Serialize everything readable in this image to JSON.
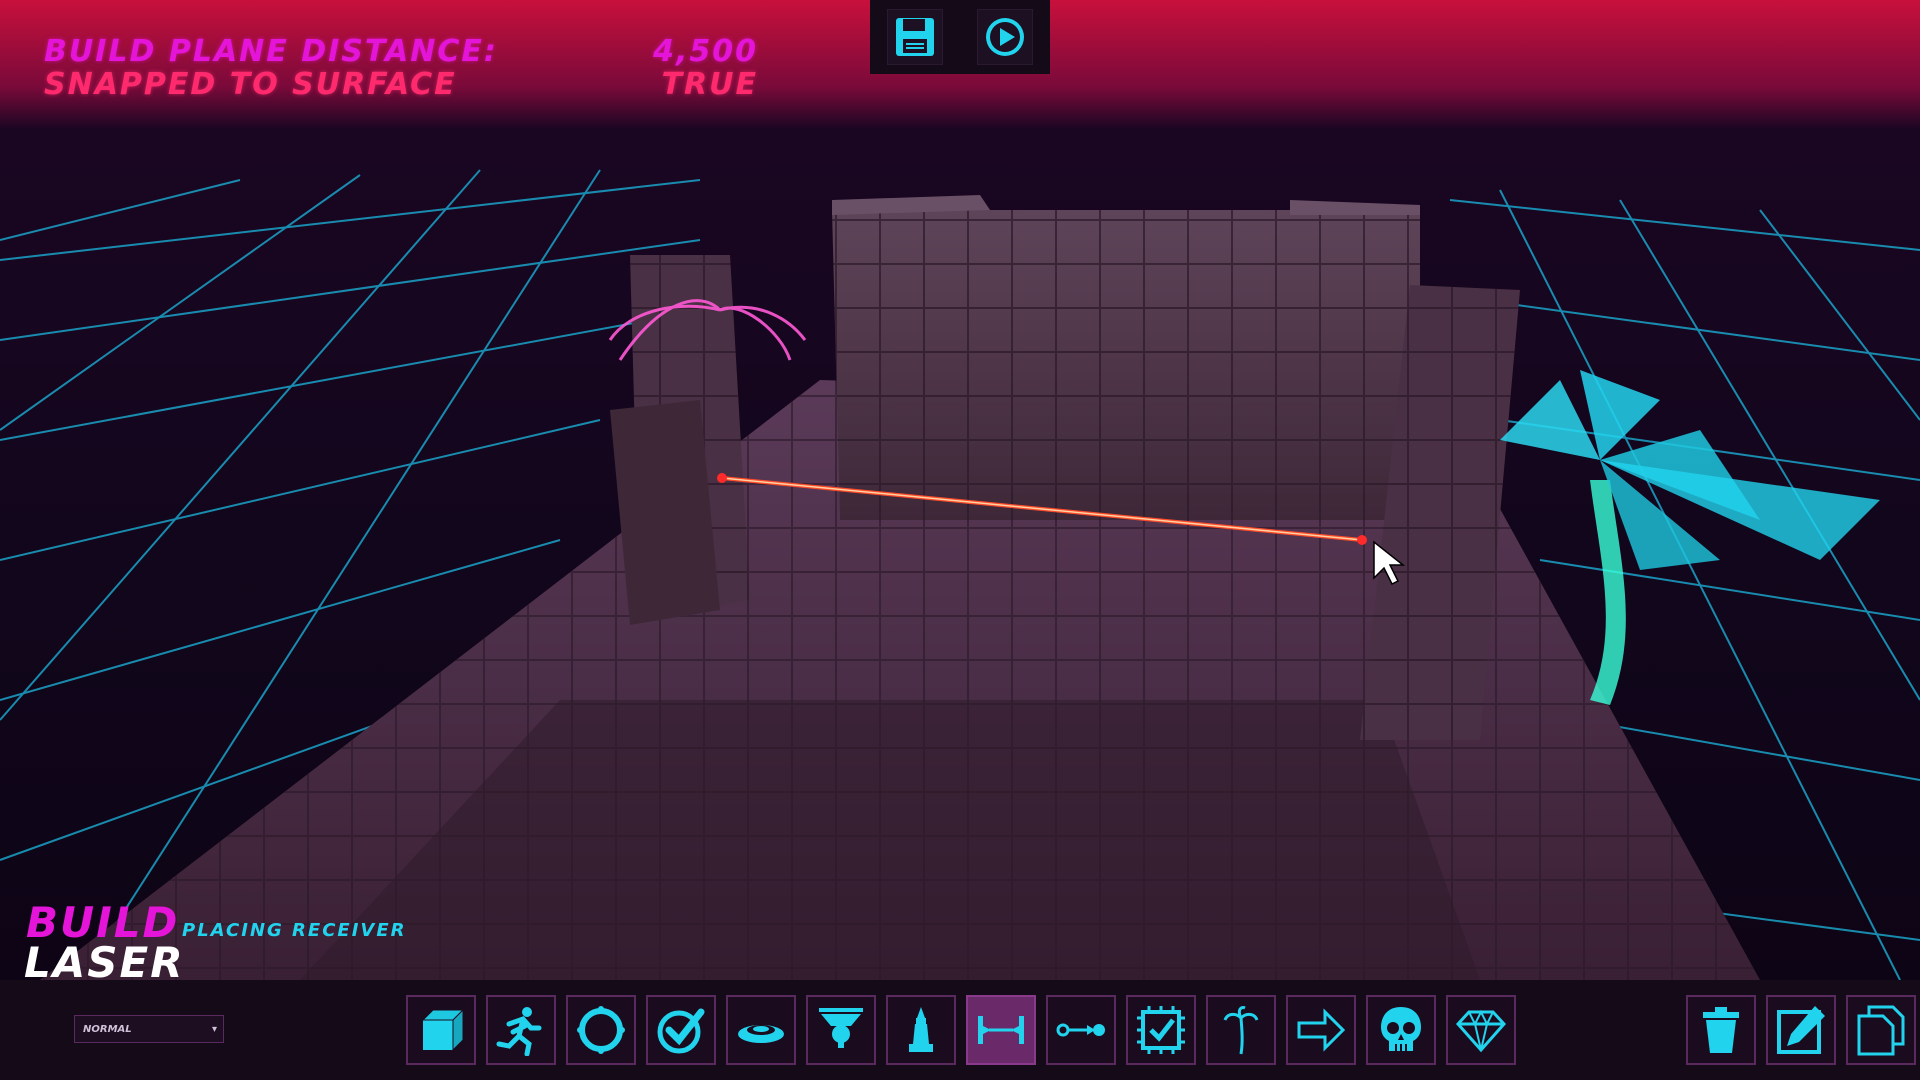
{
  "hud": {
    "build_plane_label": "BUILD PLANE DISTANCE:",
    "build_plane_value": "4,500",
    "snapped_label": "SNAPPED TO SURFACE",
    "snapped_value": "TRUE"
  },
  "top_toolbar": {
    "buttons": [
      {
        "icon": "save-icon"
      },
      {
        "icon": "play-icon"
      }
    ]
  },
  "mode": {
    "title": "BUILD",
    "status": "PLACING RECEIVER",
    "tool": "LASER"
  },
  "bottom_bar": {
    "mode_select_value": "NORMAL",
    "tools": [
      {
        "icon": "cube-icon"
      },
      {
        "icon": "runner-icon"
      },
      {
        "icon": "ring-icon"
      },
      {
        "icon": "checkmark-badge-icon"
      },
      {
        "icon": "disc-platform-icon"
      },
      {
        "icon": "ceiling-turret-icon"
      },
      {
        "icon": "tower-icon"
      },
      {
        "icon": "laser-icon",
        "active": true
      },
      {
        "icon": "connector-icon"
      },
      {
        "icon": "chip-check-icon"
      },
      {
        "icon": "palm-tree-icon"
      },
      {
        "icon": "arrow-right-icon"
      },
      {
        "icon": "skull-icon"
      },
      {
        "icon": "diamond-icon"
      }
    ],
    "actions": [
      {
        "icon": "trash-icon"
      },
      {
        "icon": "edit-icon"
      },
      {
        "icon": "copy-icon"
      }
    ]
  },
  "colors": {
    "magenta": "#e415d8",
    "red": "#ff2a6d",
    "cyan": "#22d3ee",
    "grid": "#1aa3c8",
    "laser": "#ff4a2a"
  }
}
